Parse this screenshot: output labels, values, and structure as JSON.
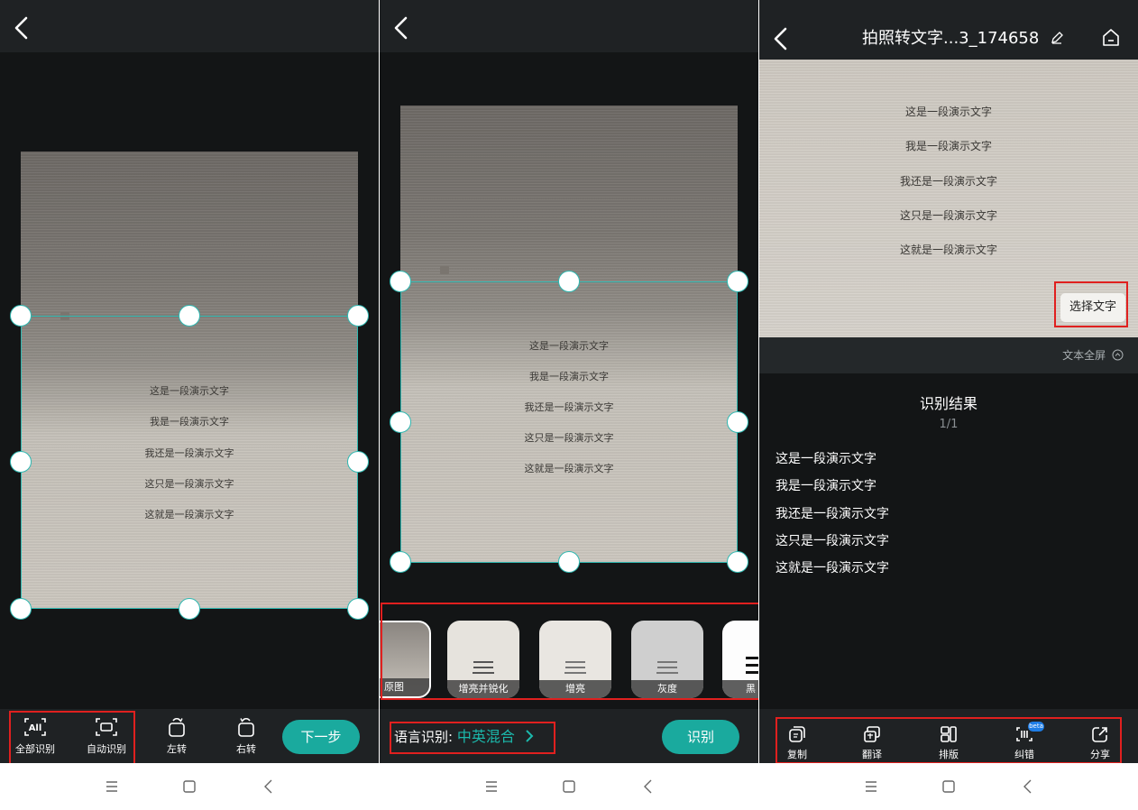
{
  "panel1": {
    "doc_lines": [
      "这是一段演示文字",
      "我是一段演示文字",
      "我还是一段演示文字",
      "这只是一段演示文字",
      "这就是一段演示文字"
    ],
    "tools": [
      {
        "icon": "all-recognize-icon",
        "label": "全部识别",
        "glyph": "All"
      },
      {
        "icon": "auto-recognize-icon",
        "label": "自动识别"
      },
      {
        "icon": "rotate-left-icon",
        "label": "左转"
      },
      {
        "icon": "rotate-right-icon",
        "label": "右转"
      }
    ],
    "next_button": "下一步"
  },
  "panel2": {
    "doc_lines": [
      "这是一段演示文字",
      "我是一段演示文字",
      "我还是一段演示文字",
      "这只是一段演示文字",
      "这就是一段演示文字"
    ],
    "filters": [
      "原图",
      "增亮并锐化",
      "增亮",
      "灰度",
      "黑"
    ],
    "selected_filter": "原图",
    "language_label": "语言识别:",
    "language_value": "中英混合",
    "recognize_button": "识别"
  },
  "panel3": {
    "title": "拍照转文字...3_174658",
    "doc_lines": [
      "这是一段演示文字",
      "我是一段演示文字",
      "我还是一段演示文字",
      "这只是一段演示文字",
      "这就是一段演示文字"
    ],
    "select_text_button": "选择文字",
    "fullscreen_label": "文本全屏",
    "result_title": "识别结果",
    "result_page": "1/1",
    "result_lines": [
      "这是一段演示文字",
      "我是一段演示文字",
      "我还是一段演示文字",
      "这只是一段演示文字",
      "这就是一段演示文字"
    ],
    "actions": [
      {
        "icon": "copy-icon",
        "label": "复制"
      },
      {
        "icon": "translate-icon",
        "label": "翻译"
      },
      {
        "icon": "layout-icon",
        "label": "排版"
      },
      {
        "icon": "proofread-icon",
        "label": "纠错",
        "badge": "beta"
      },
      {
        "icon": "share-icon",
        "label": "分享"
      }
    ]
  },
  "colors": {
    "accent": "#1aaa9e",
    "accent_text": "#1bb9ac",
    "handle_border": "#2fb8b1",
    "highlight_box": "#e0201f",
    "panel_bg": "#131516",
    "bar_bg": "#1f2224"
  }
}
